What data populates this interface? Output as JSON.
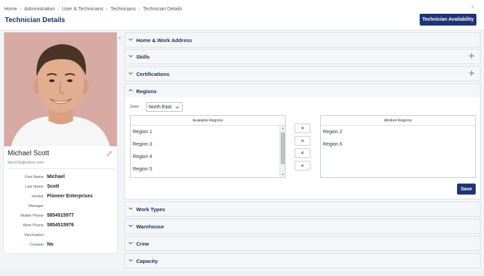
{
  "breadcrumb": [
    "Home",
    "Administration",
    "User & Technicians",
    "Technicians",
    "Technician Details"
  ],
  "page_title": "Technician Details",
  "header_button": "Technician Availability",
  "profile": {
    "name": "Michael Scott",
    "email": "dom21k@yahoo.com",
    "fields": [
      {
        "label": "First Name",
        "value": "Michael"
      },
      {
        "label": "Last Name",
        "value": "Scott"
      },
      {
        "label": "Vendor",
        "value": "Pioneer Enterprises"
      },
      {
        "label": "Manager",
        "value": ""
      },
      {
        "label": "Mobile Phone",
        "value": "5854515977"
      },
      {
        "label": "Work Phone",
        "value": "5854515976"
      },
      {
        "label": "Vaccination",
        "value": ""
      },
      {
        "label": "Couaxin",
        "value": "No"
      }
    ]
  },
  "sections": [
    {
      "title": "Home & Work Address",
      "has_plus": false,
      "expanded": false
    },
    {
      "title": "Skills",
      "has_plus": true,
      "expanded": false
    },
    {
      "title": "Certifications",
      "has_plus": true,
      "expanded": false
    },
    {
      "title": "Regions",
      "has_plus": false,
      "expanded": true
    },
    {
      "title": "Work Types",
      "has_plus": false,
      "expanded": false
    },
    {
      "title": "Warehouse",
      "has_plus": false,
      "expanded": false
    },
    {
      "title": "Crew",
      "has_plus": false,
      "expanded": false
    },
    {
      "title": "Capacity",
      "has_plus": false,
      "expanded": false
    }
  ],
  "regions": {
    "zone_label": "Zone",
    "zone_value": "North East",
    "available_header": "Available Regions",
    "available": [
      "Region 1",
      "Region 3",
      "Region 4",
      "Region 5"
    ],
    "allotted_header": "Allotted Regions",
    "allotted": [
      "Region 2",
      "Region 6"
    ],
    "move_buttons": [
      ">",
      "»",
      "<",
      "«"
    ],
    "save_label": "Save"
  },
  "colors": {
    "brand": "#1f3478",
    "title": "#1f2d5c",
    "photo_bg": "#d7aaa3"
  }
}
